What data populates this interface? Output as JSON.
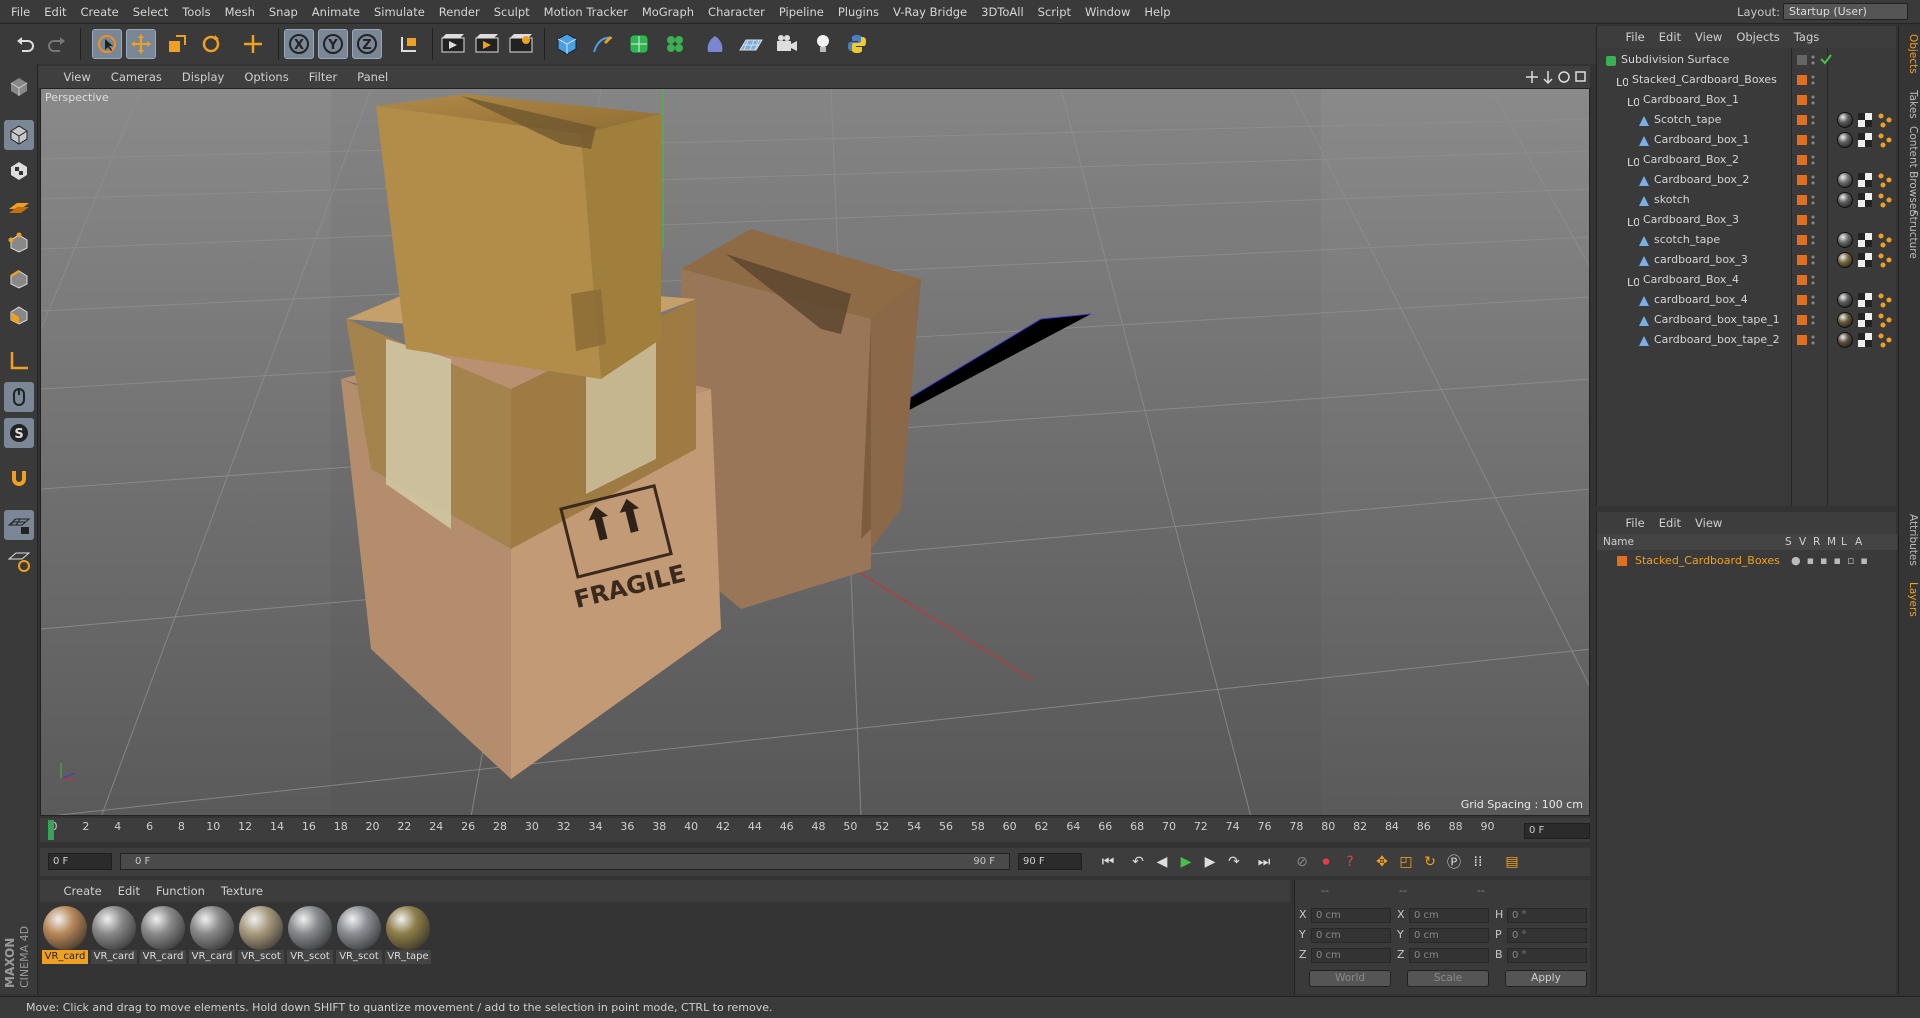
{
  "menu": [
    "File",
    "Edit",
    "Create",
    "Select",
    "Tools",
    "Mesh",
    "Snap",
    "Animate",
    "Simulate",
    "Render",
    "Sculpt",
    "Motion Tracker",
    "MoGraph",
    "Character",
    "Pipeline",
    "Plugins",
    "V-Ray Bridge",
    "3DToAll",
    "Script",
    "Window",
    "Help"
  ],
  "layout": {
    "label": "Layout:",
    "value": "Startup (User)"
  },
  "viewport": {
    "menu": [
      "View",
      "Cameras",
      "Display",
      "Options",
      "Filter",
      "Panel"
    ],
    "label": "Perspective",
    "grid_spacing": "Grid Spacing : 100 cm",
    "box_text": "FRAGILE"
  },
  "timeline": {
    "ticks": [
      "0",
      "2",
      "4",
      "6",
      "8",
      "10",
      "12",
      "14",
      "16",
      "18",
      "20",
      "22",
      "24",
      "26",
      "28",
      "30",
      "32",
      "34",
      "36",
      "38",
      "40",
      "42",
      "44",
      "46",
      "48",
      "50",
      "52",
      "54",
      "56",
      "58",
      "60",
      "62",
      "64",
      "66",
      "68",
      "70",
      "72",
      "74",
      "76",
      "78",
      "80",
      "82",
      "84",
      "86",
      "88",
      "90"
    ],
    "frame_right": "0 F",
    "current": "0 F",
    "scrub_start": "0 F",
    "scrub_end": "90 F",
    "end": "90 F"
  },
  "materials": {
    "menu": [
      "Create",
      "Edit",
      "Function",
      "Texture"
    ],
    "items": [
      {
        "label": "VR_card",
        "color": "#b8895a"
      },
      {
        "label": "VR_card",
        "color": "#8a8a8a"
      },
      {
        "label": "VR_card",
        "color": "#8a8a8a"
      },
      {
        "label": "VR_card",
        "color": "#8a8a8a"
      },
      {
        "label": "VR_scot",
        "color": "#a89a7e"
      },
      {
        "label": "VR_scot",
        "color": "#888a8e"
      },
      {
        "label": "VR_scot",
        "color": "#8c8e94"
      },
      {
        "label": "VR_tape",
        "color": "#8e7f4a"
      }
    ]
  },
  "coords": {
    "header": [
      "--",
      "--",
      "--"
    ],
    "rows": [
      {
        "a": "X",
        "v1": "0 cm",
        "b": "X",
        "v2": "0 cm",
        "c": "H",
        "v3": "0 °"
      },
      {
        "a": "Y",
        "v1": "0 cm",
        "b": "Y",
        "v2": "0 cm",
        "c": "P",
        "v3": "0 °"
      },
      {
        "a": "Z",
        "v1": "0 cm",
        "b": "Z",
        "v2": "0 cm",
        "c": "B",
        "v3": "0 °"
      }
    ],
    "world": "World",
    "scale": "Scale",
    "apply": "Apply"
  },
  "status": "Move: Click and drag to move elements. Hold down SHIFT to quantize movement / add to the selection in point mode, CTRL to remove.",
  "objects": {
    "menu": [
      "File",
      "Edit",
      "View",
      "Objects",
      "Tags"
    ],
    "tree": [
      {
        "name": "Subdivision Surface",
        "depth": 0,
        "kind": "subd"
      },
      {
        "name": "Stacked_Cardboard_Boxes",
        "depth": 1,
        "kind": "null"
      },
      {
        "name": "Cardboard_Box_1",
        "depth": 2,
        "kind": "null"
      },
      {
        "name": "Scotch_tape",
        "depth": 3,
        "kind": "poly"
      },
      {
        "name": "Cardboard_box_1",
        "depth": 3,
        "kind": "poly"
      },
      {
        "name": "Cardboard_Box_2",
        "depth": 2,
        "kind": "null"
      },
      {
        "name": "Cardboard_box_2",
        "depth": 3,
        "kind": "poly"
      },
      {
        "name": "skotch",
        "depth": 3,
        "kind": "poly"
      },
      {
        "name": "Cardboard_Box_3",
        "depth": 2,
        "kind": "null"
      },
      {
        "name": "scotch_tape",
        "depth": 3,
        "kind": "poly"
      },
      {
        "name": "cardboard_box_3",
        "depth": 3,
        "kind": "poly"
      },
      {
        "name": "Cardboard_Box_4",
        "depth": 2,
        "kind": "null"
      },
      {
        "name": "cardboard_box_4",
        "depth": 3,
        "kind": "poly"
      },
      {
        "name": "Cardboard_box_tape_1",
        "depth": 3,
        "kind": "poly"
      },
      {
        "name": "Cardboard_box_tape_2",
        "depth": 3,
        "kind": "poly"
      }
    ]
  },
  "layers": {
    "menu": [
      "File",
      "Edit",
      "View"
    ],
    "header": {
      "name": "Name",
      "cols": [
        "S",
        "V",
        "R",
        "M",
        "L",
        "A"
      ]
    },
    "items": [
      {
        "name": "Stacked_Cardboard_Boxes"
      }
    ]
  },
  "vtabs": [
    "Objects",
    "Takes",
    "Content Browser",
    "Structure",
    "Attributes",
    "Layers"
  ],
  "branding": {
    "line1": "MAXON",
    "line2": "CINEMA 4D"
  },
  "colors": {
    "accent": "#f0a020",
    "layer_color": "#e06f20",
    "selected_tool": "#7a8796"
  }
}
